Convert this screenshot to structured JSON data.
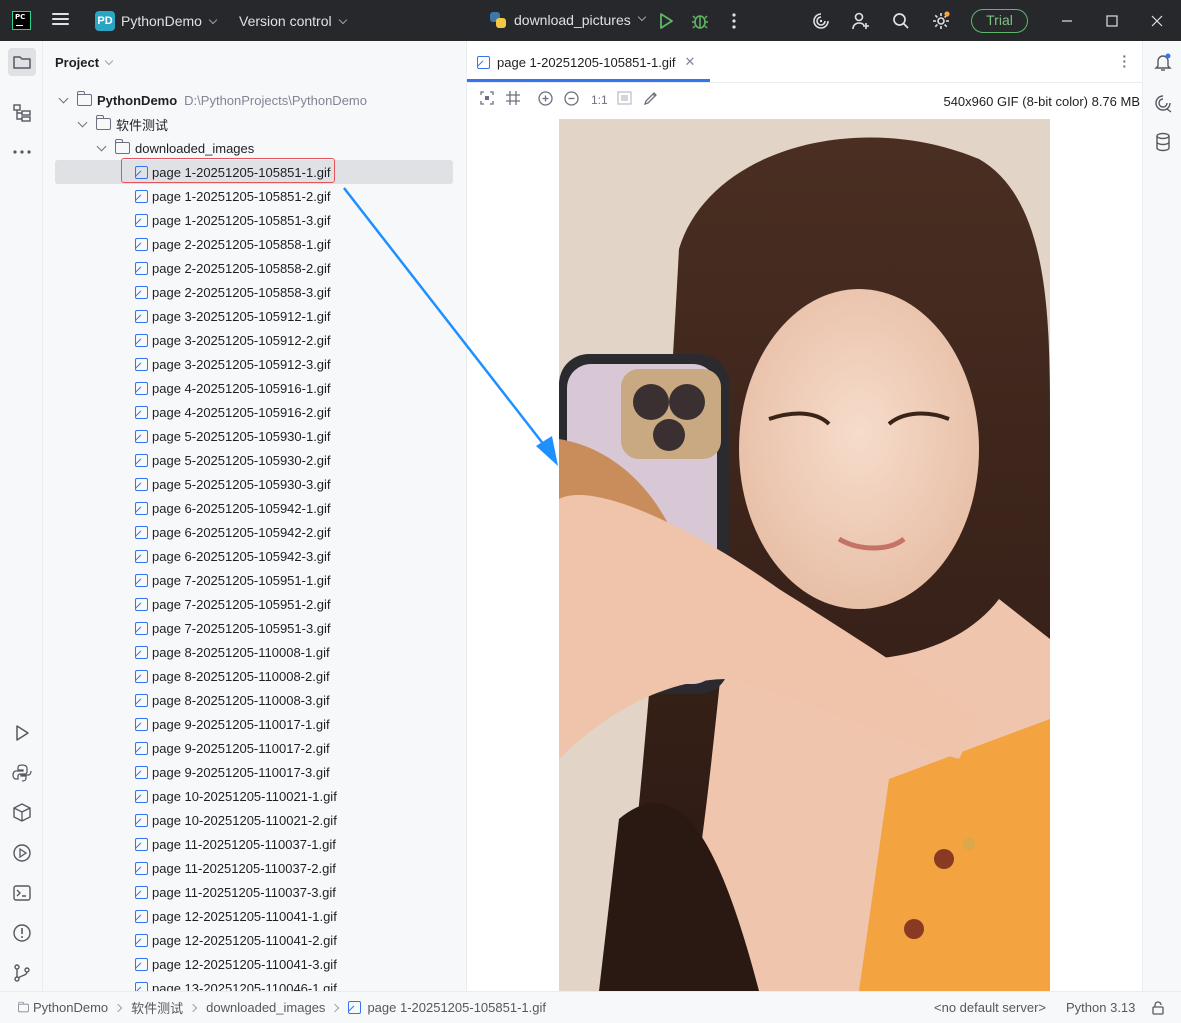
{
  "titlebar": {
    "project_badge": "PD",
    "project_name": "PythonDemo",
    "version_control": "Version control",
    "run_config": "download_pictures",
    "trial_label": "Trial",
    "logo_text": "PC"
  },
  "project_panel": {
    "title": "Project",
    "root_name": "PythonDemo",
    "root_path": "D:\\PythonProjects\\PythonDemo",
    "folder1": "软件测试",
    "folder2": "downloaded_images",
    "files": [
      "page 1-20251205-105851-1.gif",
      "page 1-20251205-105851-2.gif",
      "page 1-20251205-105851-3.gif",
      "page 2-20251205-105858-1.gif",
      "page 2-20251205-105858-2.gif",
      "page 2-20251205-105858-3.gif",
      "page 3-20251205-105912-1.gif",
      "page 3-20251205-105912-2.gif",
      "page 3-20251205-105912-3.gif",
      "page 4-20251205-105916-1.gif",
      "page 4-20251205-105916-2.gif",
      "page 5-20251205-105930-1.gif",
      "page 5-20251205-105930-2.gif",
      "page 5-20251205-105930-3.gif",
      "page 6-20251205-105942-1.gif",
      "page 6-20251205-105942-2.gif",
      "page 6-20251205-105942-3.gif",
      "page 7-20251205-105951-1.gif",
      "page 7-20251205-105951-2.gif",
      "page 7-20251205-105951-3.gif",
      "page 8-20251205-110008-1.gif",
      "page 8-20251205-110008-2.gif",
      "page 8-20251205-110008-3.gif",
      "page 9-20251205-110017-1.gif",
      "page 9-20251205-110017-2.gif",
      "page 9-20251205-110017-3.gif",
      "page 10-20251205-110021-1.gif",
      "page 10-20251205-110021-2.gif",
      "page 11-20251205-110037-1.gif",
      "page 11-20251205-110037-2.gif",
      "page 11-20251205-110037-3.gif",
      "page 12-20251205-110041-1.gif",
      "page 12-20251205-110041-2.gif",
      "page 12-20251205-110041-3.gif",
      "page 13-20251205-110046-1.gif"
    ]
  },
  "editor": {
    "tab_label": "page 1-20251205-105851-1.gif",
    "zoom_actual": "1:1",
    "image_info": "540x960 GIF (8-bit color) 8.76 MB"
  },
  "statusbar": {
    "crumb_project": "PythonDemo",
    "crumb_folder1": "软件测试",
    "crumb_folder2": "downloaded_images",
    "crumb_file": "page 1-20251205-105851-1.gif",
    "server": "<no default server>",
    "interpreter": "Python 3.13"
  },
  "colors": {
    "accent": "#3574f0",
    "titlebar_bg": "#27282c",
    "selection_outline": "#e5545a",
    "annotation_arrow": "#1e90ff",
    "run_green": "#5fb865"
  }
}
